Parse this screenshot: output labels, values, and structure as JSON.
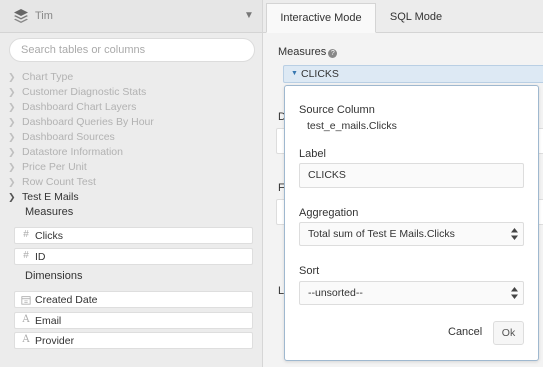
{
  "sidebar": {
    "database": "Tim",
    "search_placeholder": "Search tables or columns",
    "tables": [
      "Chart Type",
      "Customer Diagnostic Stats",
      "Dashboard Chart Layers",
      "Dashboard Queries By Hour",
      "Dashboard Sources",
      "Datastore Information",
      "Price Per Unit",
      "Row Count Test"
    ],
    "open_table": "Test E Mails",
    "measures_label": "Measures",
    "measures": [
      {
        "glyph": "#",
        "name": "Clicks"
      },
      {
        "glyph": "#",
        "name": "ID"
      }
    ],
    "dimensions_label": "Dimensions",
    "dimensions": [
      {
        "glyph": "calendar",
        "name": "Created Date"
      },
      {
        "glyph": "A",
        "name": "Email"
      },
      {
        "glyph": "A",
        "name": "Provider"
      }
    ]
  },
  "tabs": {
    "interactive": "Interactive Mode",
    "sql": "SQL Mode"
  },
  "main": {
    "measures_label": "Measures",
    "measure_pill": "CLICKS",
    "partial_labels": [
      "D",
      "F",
      "L"
    ]
  },
  "popover": {
    "source_column_label": "Source Column",
    "source_column_value": "test_e_mails.Clicks",
    "label_label": "Label",
    "label_value": "CLICKS",
    "aggregation_label": "Aggregation",
    "aggregation_value": "Total sum of Test E Mails.Clicks",
    "sort_label": "Sort",
    "sort_value": "--unsorted--",
    "cancel": "Cancel",
    "ok": "Ok"
  },
  "colors": {
    "accent_blue": "#3777b0",
    "pill_bg": "#dde9f4"
  }
}
